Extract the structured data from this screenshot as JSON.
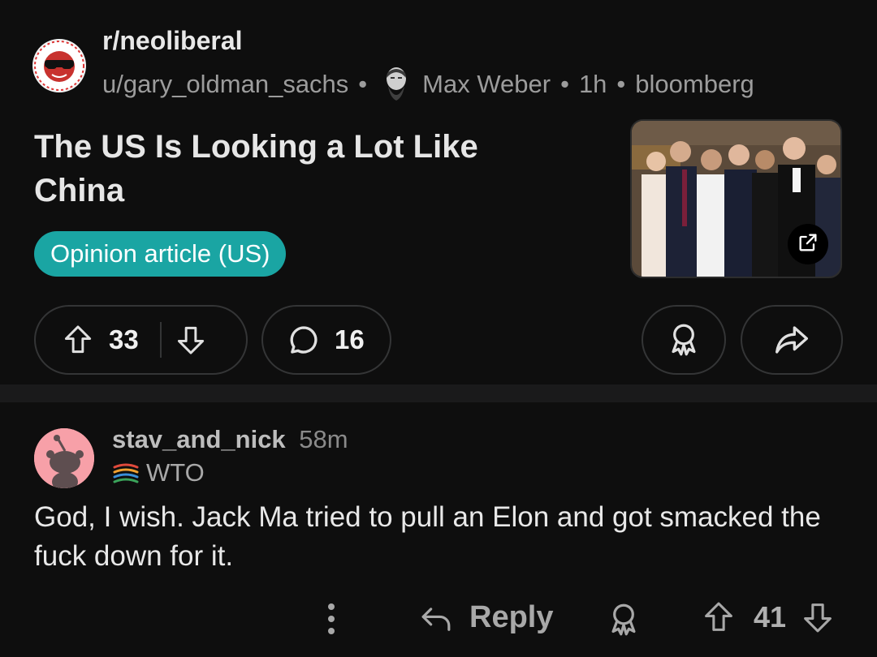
{
  "post": {
    "subreddit": "r/neoliberal",
    "author": "u/gary_oldman_sachs",
    "separator": "•",
    "author_flair": "Max Weber",
    "time": "1h",
    "domain": "bloomberg",
    "title": "The US Is Looking a Lot Like China",
    "tag": "Opinion article (US)",
    "tag_color": "#1aa5a3",
    "upvotes": "33",
    "comments": "16",
    "icons": [
      "upvote-icon",
      "downvote-icon",
      "comment-icon",
      "award-icon",
      "share-icon",
      "external-link-icon"
    ]
  },
  "comment": {
    "username": "stav_and_nick",
    "time": "58m",
    "flair": "WTO",
    "body": "God, I wish. Jack Ma tried to pull an Elon and got smacked the fuck down for it.",
    "reply_label": "Reply",
    "votes": "41",
    "avatar_color": "#f7a0a8"
  },
  "colors": {
    "background": "#0e0e0e",
    "divider": "#1a1a1b",
    "border": "#343536"
  }
}
